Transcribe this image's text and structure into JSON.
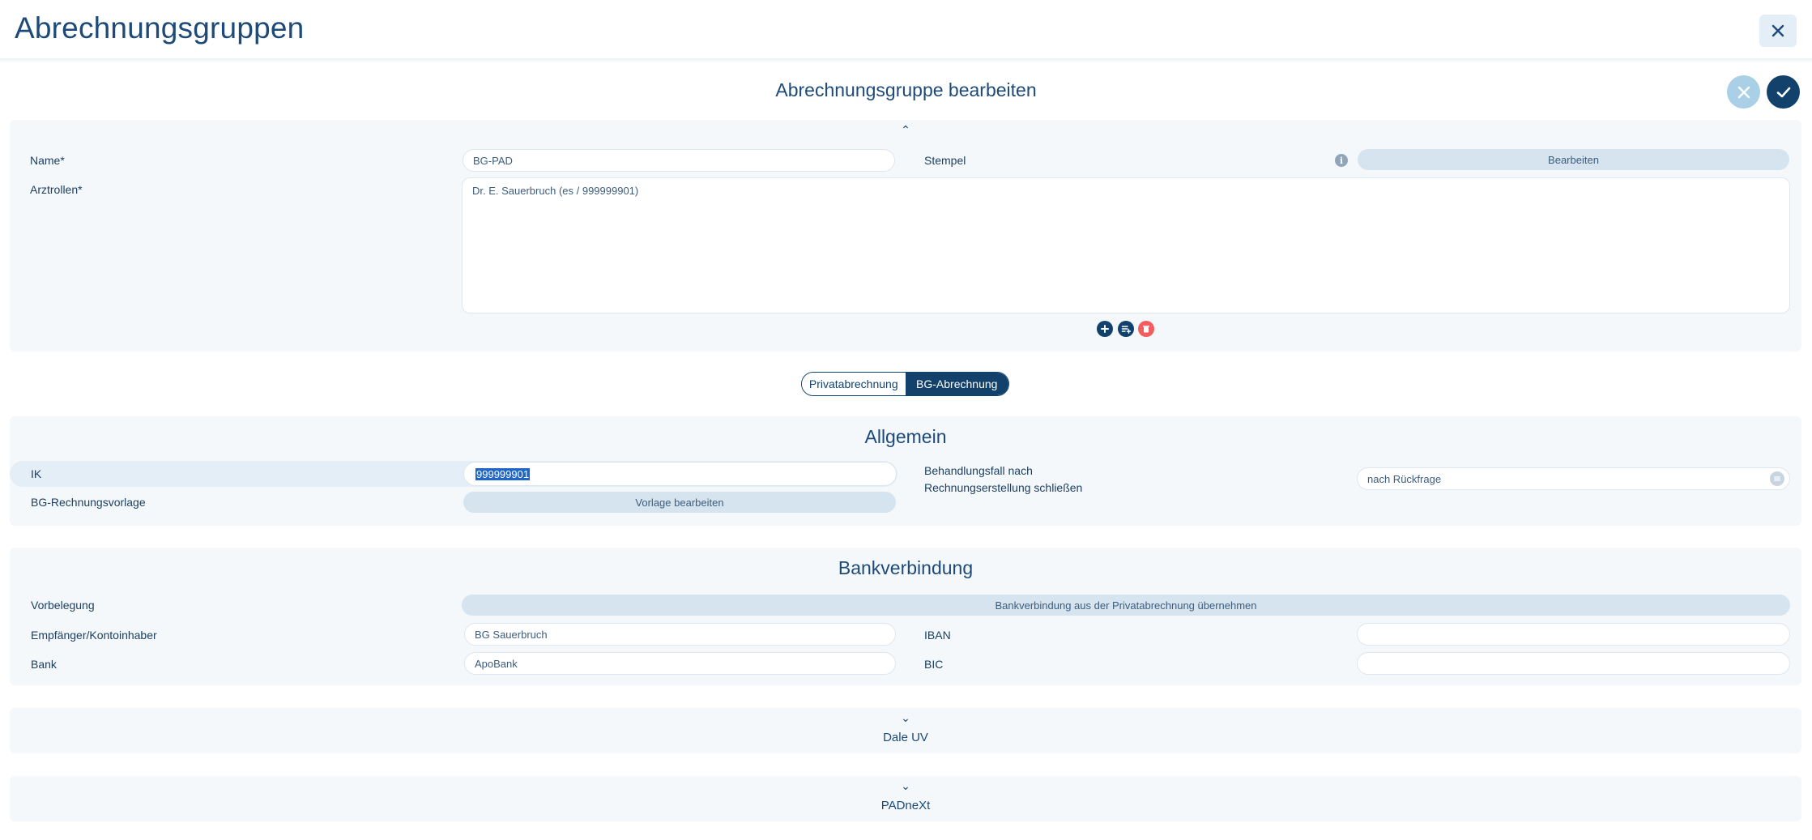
{
  "page": {
    "title": "Abrechnungsgruppen"
  },
  "editor": {
    "title": "Abrechnungsgruppe bearbeiten"
  },
  "general": {
    "name_label": "Name*",
    "name_value": "BG-PAD",
    "stempel_label": "Stempel",
    "stempel_button": "Bearbeiten",
    "arztrollen_label": "Arztrollen*",
    "arztrollen_items": [
      "Dr. E. Sauerbruch (es / 999999901)"
    ],
    "collapse_chevron": "⌃"
  },
  "billing_toggle": {
    "options": [
      "Privatabrechnung",
      "BG-Abrechnung"
    ],
    "active": "BG-Abrechnung"
  },
  "allgemein": {
    "title": "Allgemein",
    "ik_label": "IK",
    "ik_value": "999999901",
    "vorlage_label": "BG-Rechnungsvorlage",
    "vorlage_button": "Vorlage bearbeiten",
    "behandlungsfall_label_line1": "Behandlungsfall nach",
    "behandlungsfall_label_line2": "Rechnungserstellung schließen",
    "behandlungsfall_value": "nach Rückfrage"
  },
  "bank": {
    "title": "Bankverbindung",
    "vorbelegung_label": "Vorbelegung",
    "vorbelegung_button": "Bankverbindung aus der Privatabrechnung übernehmen",
    "empfaenger_label": "Empfänger/Kontoinhaber",
    "empfaenger_value": "BG Sauerbruch",
    "bank_label": "Bank",
    "bank_value": "ApoBank",
    "iban_label": "IBAN",
    "iban_value": "",
    "bic_label": "BIC",
    "bic_value": ""
  },
  "collapsed_sections": [
    {
      "title": "Dale UV",
      "chevron": "⌄"
    },
    {
      "title": "PADneXt",
      "chevron": "⌄"
    }
  ],
  "colors": {
    "primary": "#12426b",
    "accent_light": "#a9d0e6",
    "delete": "#f25d5d",
    "section_bg": "#f4f8fb"
  }
}
